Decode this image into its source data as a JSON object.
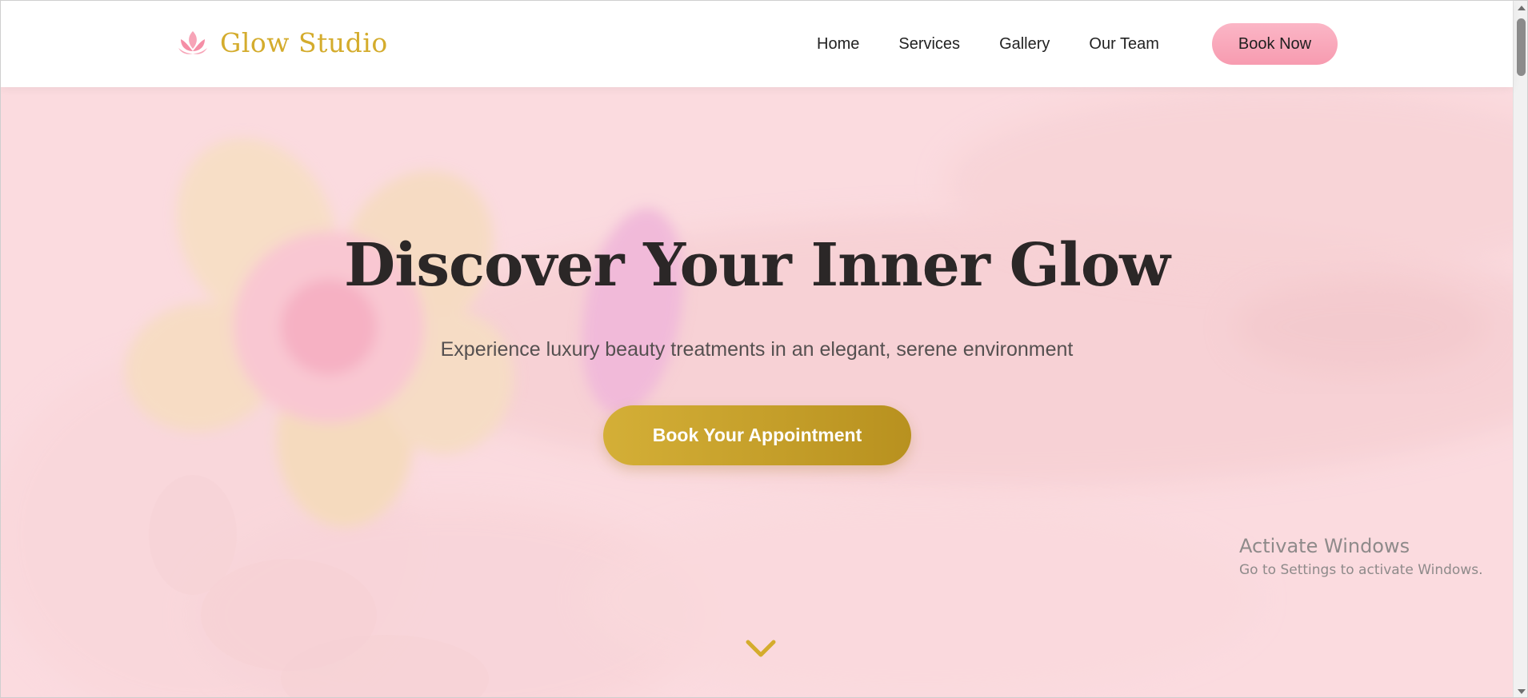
{
  "header": {
    "logo_text": "Glow Studio",
    "logo_icon": "lotus-icon",
    "nav": [
      {
        "label": "Home"
      },
      {
        "label": "Services"
      },
      {
        "label": "Gallery"
      },
      {
        "label": "Our Team"
      }
    ],
    "book_label": "Book Now"
  },
  "hero": {
    "title": "Discover Your Inner Glow",
    "subtitle": "Experience luxury beauty treatments in an elegant, serene environment",
    "cta_label": "Book Your Appointment",
    "scroll_icon": "chevron-down-icon",
    "background": "flower-in-hands-photo"
  },
  "os_overlay": {
    "title": "Activate Windows",
    "subtitle": "Go to Settings to activate Windows."
  },
  "colors": {
    "brand_gold": "#d4ac2d",
    "cta_gold_start": "#d4af37",
    "cta_gold_end": "#b8911f",
    "pink_button": "#f9a8ba",
    "hero_tint": "#fde1e5",
    "title_text": "#2b2727"
  }
}
